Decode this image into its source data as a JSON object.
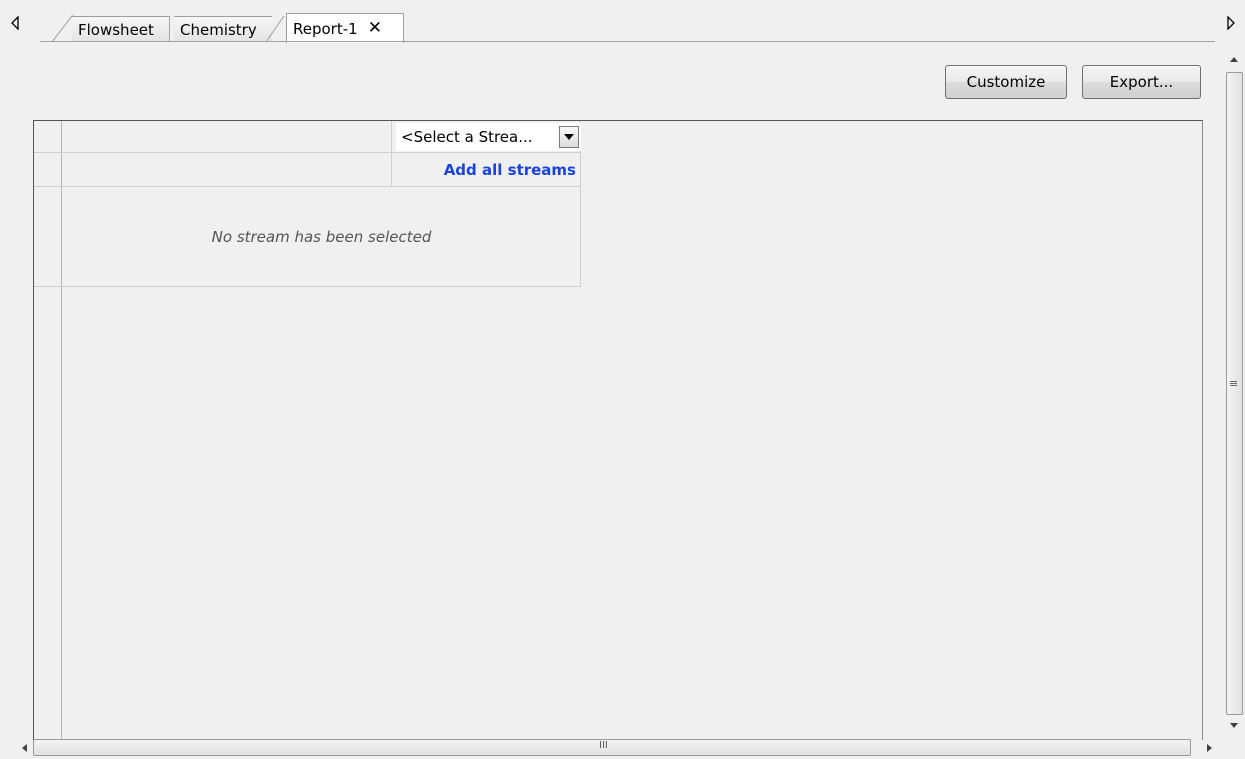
{
  "tabs": [
    {
      "label": "Flowsheet",
      "active": false
    },
    {
      "label": "Chemistry",
      "active": false
    },
    {
      "label": "Report-1",
      "active": true,
      "closable": true
    }
  ],
  "tab_close_glyph": "✕",
  "toolbar": {
    "customize_label": "Customize",
    "export_label": "Export..."
  },
  "report": {
    "stream_select_value": "<Select a Strea...",
    "add_all_streams_label": "Add all streams",
    "empty_message": "No stream has been selected"
  },
  "scrollbar_grip": "≡",
  "hscrollbar_grip": "III",
  "colors": {
    "link": "#1a44dd",
    "background": "#f0f0f0"
  }
}
